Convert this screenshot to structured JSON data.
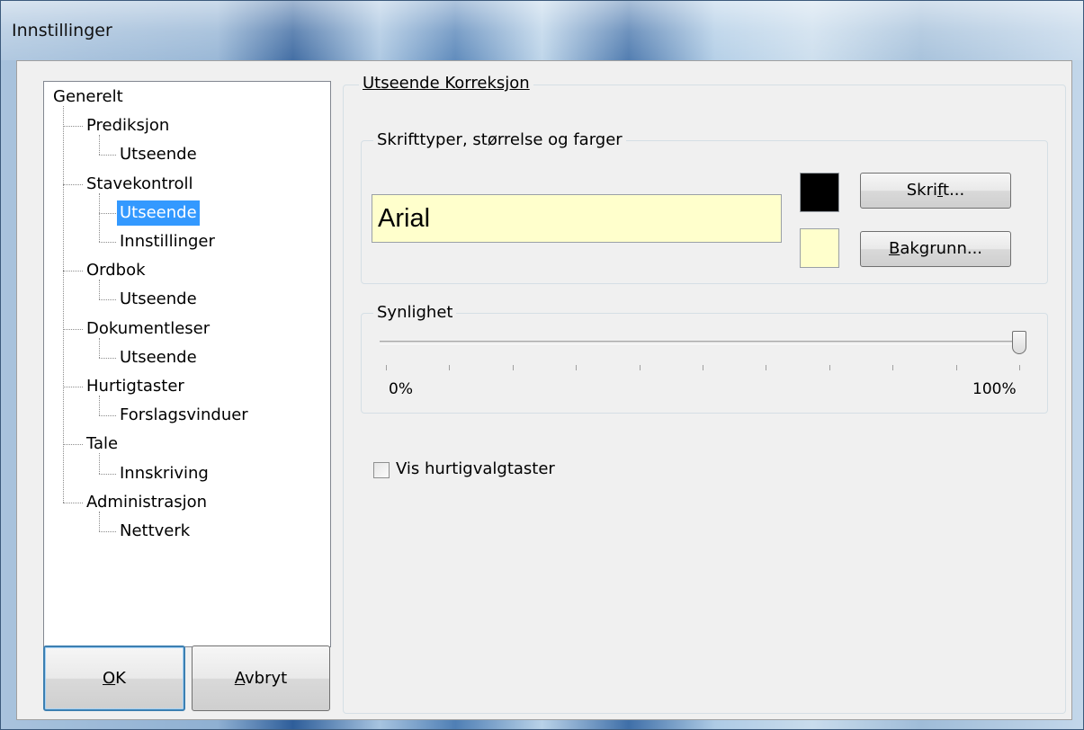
{
  "window": {
    "title": "Innstillinger"
  },
  "tree": {
    "items": [
      {
        "label": "Generelt",
        "level": 0
      },
      {
        "label": "Prediksjon",
        "level": 1
      },
      {
        "label": "Utseende",
        "level": 2
      },
      {
        "label": "Stavekontroll",
        "level": 1
      },
      {
        "label": "Utseende",
        "level": 2,
        "selected": true
      },
      {
        "label": "Innstillinger",
        "level": 2
      },
      {
        "label": "Ordbok",
        "level": 1
      },
      {
        "label": "Utseende",
        "level": 2
      },
      {
        "label": "Dokumentleser",
        "level": 1
      },
      {
        "label": "Utseende",
        "level": 2
      },
      {
        "label": "Hurtigtaster",
        "level": 1
      },
      {
        "label": "Forslagsvinduer",
        "level": 2
      },
      {
        "label": "Tale",
        "level": 1
      },
      {
        "label": "Innskriving",
        "level": 2
      },
      {
        "label": "Administrasjon",
        "level": 1
      },
      {
        "label": "Nettverk",
        "level": 2
      }
    ]
  },
  "buttons": {
    "ok": {
      "mnemonic": "O",
      "rest": "K"
    },
    "cancel": {
      "mnemonic": "A",
      "rest": "vbryt"
    },
    "font": {
      "pre": "Skri",
      "mnemonic": "f",
      "post": "t..."
    },
    "background": {
      "mnemonic": "B",
      "rest": "akgrunn..."
    }
  },
  "section": {
    "title": "Utseende Korreksjon",
    "fonts_group": {
      "title": "Skrifttyper, størrelse og farger",
      "preview_text": "Arial",
      "text_color": "#000000",
      "background_color": "#ffffcc"
    },
    "visibility_group": {
      "title": "Synlighet",
      "min_label": "0%",
      "max_label": "100%",
      "value_percent": 100
    },
    "checkbox": {
      "label": "Vis hurtigvalgtaster",
      "checked": false
    }
  },
  "colors": {
    "selection": "#3399ff",
    "client_bg": "#f0f0f0"
  }
}
